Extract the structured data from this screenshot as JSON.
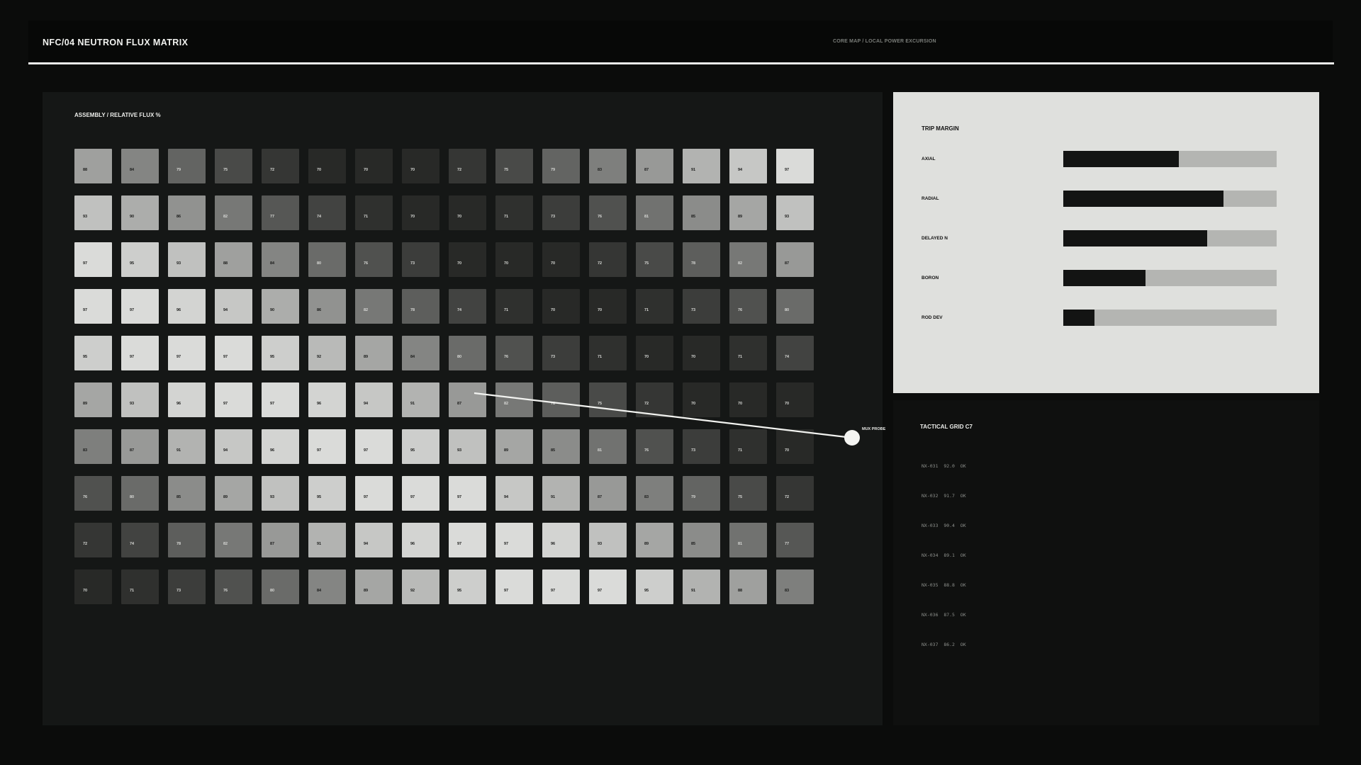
{
  "header": {
    "title": "NFC/04  NEUTRON FLUX MATRIX",
    "subtitle": "CORE MAP / LOCAL POWER EXCURSION"
  },
  "matrix": {
    "label": "ASSEMBLY / RELATIVE FLUX %",
    "rows": [
      [
        "88",
        "84",
        "79",
        "75",
        "72",
        "70",
        "70",
        "70",
        "72",
        "75",
        "79",
        "83",
        "87",
        "91",
        "94",
        "97"
      ],
      [
        "93",
        "90",
        "86",
        "82",
        "77",
        "74",
        "71",
        "70",
        "70",
        "71",
        "73",
        "76",
        "81",
        "85",
        "89",
        "93"
      ],
      [
        "97",
        "95",
        "93",
        "88",
        "84",
        "80",
        "76",
        "73",
        "70",
        "70",
        "70",
        "72",
        "75",
        "78",
        "82",
        "87"
      ],
      [
        "97",
        "97",
        "96",
        "94",
        "90",
        "86",
        "82",
        "78",
        "74",
        "71",
        "70",
        "70",
        "71",
        "73",
        "76",
        "80"
      ],
      [
        "95",
        "97",
        "97",
        "97",
        "95",
        "92",
        "89",
        "84",
        "80",
        "76",
        "73",
        "71",
        "70",
        "70",
        "71",
        "74"
      ],
      [
        "89",
        "93",
        "96",
        "97",
        "97",
        "96",
        "94",
        "91",
        "87",
        "82",
        "78",
        "75",
        "72",
        "70",
        "70",
        "70"
      ],
      [
        "83",
        "87",
        "91",
        "94",
        "96",
        "97",
        "97",
        "95",
        "93",
        "89",
        "85",
        "81",
        "76",
        "73",
        "71",
        "70"
      ],
      [
        "76",
        "80",
        "85",
        "89",
        "93",
        "95",
        "97",
        "97",
        "97",
        "94",
        "91",
        "87",
        "83",
        "79",
        "75",
        "72"
      ],
      [
        "72",
        "74",
        "78",
        "82",
        "87",
        "91",
        "94",
        "96",
        "97",
        "97",
        "96",
        "93",
        "89",
        "85",
        "81",
        "77"
      ],
      [
        "70",
        "71",
        "73",
        "76",
        "80",
        "84",
        "89",
        "92",
        "95",
        "97",
        "97",
        "97",
        "95",
        "91",
        "88",
        "83"
      ]
    ]
  },
  "probe": {
    "label": "MUX PROBE"
  },
  "trip_margin": {
    "title": "TRIP MARGIN",
    "items": [
      {
        "label": "AXIAL",
        "fraction": 0.54
      },
      {
        "label": "RADIAL",
        "fraction": 0.75
      },
      {
        "label": "DELAYED N",
        "fraction": 0.675
      },
      {
        "label": "BORON",
        "fraction": 0.385
      },
      {
        "label": "ROD DEV",
        "fraction": 0.145
      }
    ]
  },
  "tactical_grid": {
    "title": "TACTICAL GRID C7",
    "rows": [
      {
        "id": "NX-031",
        "value": "92.0",
        "status": "OK"
      },
      {
        "id": "NX-032",
        "value": "91.7",
        "status": "OK"
      },
      {
        "id": "NX-033",
        "value": "90.4",
        "status": "OK"
      },
      {
        "id": "NX-034",
        "value": "89.1",
        "status": "OK"
      },
      {
        "id": "NX-035",
        "value": "88.8",
        "status": "OK"
      },
      {
        "id": "NX-036",
        "value": "87.5",
        "status": "OK"
      },
      {
        "id": "NX-037",
        "value": "86.2",
        "status": "OK"
      }
    ]
  }
}
